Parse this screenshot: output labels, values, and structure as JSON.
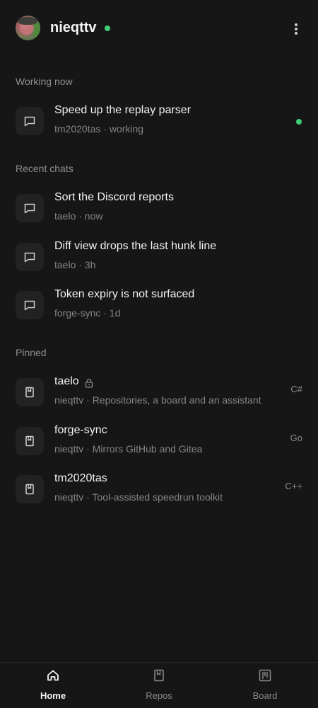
{
  "header": {
    "username": "nieqttv",
    "online": true
  },
  "sections": {
    "working_now": "Working now",
    "recent_chats": "Recent chats",
    "pinned": "Pinned"
  },
  "working": [
    {
      "title": "Speed up the replay parser",
      "meta": "tm2020tas · working",
      "icon": "chat-bubble-icon",
      "active_indicator": "green-dot"
    }
  ],
  "recent": [
    {
      "title": "Sort the Discord reports",
      "meta": "taelo · now",
      "icon": "chat-bubble-icon"
    },
    {
      "title": "Diff view drops the last hunk line",
      "meta": "taelo · 3h",
      "icon": "chat-bubble-icon"
    },
    {
      "title": "Token expiry is not surfaced",
      "meta": "forge-sync · 1d",
      "icon": "chat-bubble-icon"
    }
  ],
  "pinned": [
    {
      "name": "taelo",
      "desc": "nieqttv · Repositories, a board and an assistant",
      "lang": "C#",
      "private": true,
      "icon": "repo-book-icon"
    },
    {
      "name": "forge-sync",
      "desc": "nieqttv · Mirrors GitHub and Gitea",
      "lang": "Go",
      "private": false,
      "icon": "repo-book-icon"
    },
    {
      "name": "tm2020tas",
      "desc": "nieqttv · Tool-assisted speedrun toolkit",
      "lang": "C++",
      "private": false,
      "icon": "repo-book-icon"
    }
  ],
  "nav": [
    {
      "label": "Home",
      "icon": "home-icon",
      "active": true
    },
    {
      "label": "Repos",
      "icon": "repo-book-icon",
      "active": false
    },
    {
      "label": "Board",
      "icon": "board-columns-icon",
      "active": false
    }
  ],
  "colors": {
    "background": "#161616",
    "accent_online": "#3fcf78",
    "muted_text": "#858585",
    "tile": "#222222"
  }
}
